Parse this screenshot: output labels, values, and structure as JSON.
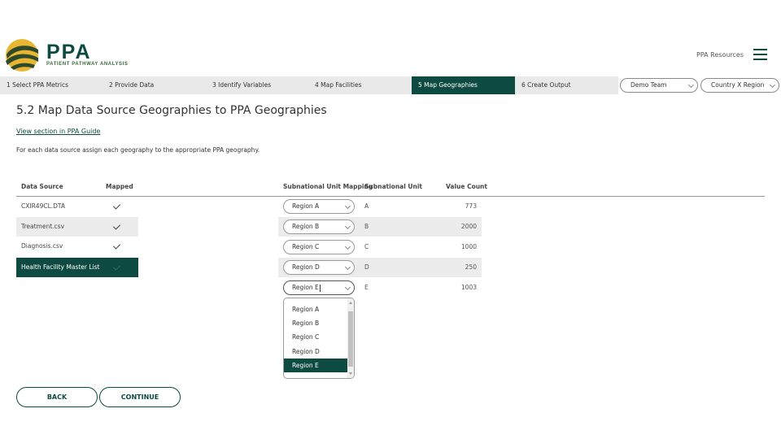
{
  "header": {
    "brand_name": "PPA",
    "brand_subtitle": "PATIENT PATHWAY ANALYSIS",
    "resources_label": "PPA Resources",
    "colors": {
      "brand_green": "#0d4a42",
      "logo_yellow": "#e9b634",
      "logo_dark_green": "#2e4a2a"
    }
  },
  "steps": [
    {
      "label": "1 Select PPA Metrics",
      "active": false
    },
    {
      "label": "2 Provide Data",
      "active": false
    },
    {
      "label": "3 Identify Variables",
      "active": false
    },
    {
      "label": "4 Map Facilities",
      "active": false
    },
    {
      "label": "5 Map Geographies",
      "active": true
    },
    {
      "label": "6 Create Output",
      "active": false
    }
  ],
  "selectors": {
    "team": "Demo Team",
    "region": "Country X Region"
  },
  "page": {
    "title": "5.2 Map Data Source Geographies to PPA Geographies",
    "guide_link": "View section in PPA Guide",
    "instructions": "For each data source assign each geography to the appropriate PPA geography."
  },
  "left_table": {
    "headers": {
      "data_source": "Data Source",
      "mapped": "Mapped"
    },
    "rows": [
      {
        "name": "CXIR49CL.DTA",
        "mapped": true,
        "shaded": false,
        "selected": false
      },
      {
        "name": "Treatment.csv",
        "mapped": true,
        "shaded": true,
        "selected": false
      },
      {
        "name": "Diagnosis.csv",
        "mapped": true,
        "shaded": false,
        "selected": false
      },
      {
        "name": "Health Facility Master List",
        "mapped": true,
        "shaded": false,
        "selected": true
      }
    ]
  },
  "right_table": {
    "headers": {
      "mapping": "Subnational Unit Mapping",
      "unit": "Subnational Unit",
      "count": "Value Count"
    },
    "rows": [
      {
        "mapping": "Region A",
        "unit": "A",
        "count": "773",
        "shaded": false
      },
      {
        "mapping": "Region B",
        "unit": "B",
        "count": "2000",
        "shaded": true
      },
      {
        "mapping": "Region C",
        "unit": "C",
        "count": "1000",
        "shaded": false
      },
      {
        "mapping": "Region D",
        "unit": "D",
        "count": "250",
        "shaded": true
      },
      {
        "mapping": "Region E",
        "unit": "E",
        "count": "1003",
        "shaded": false,
        "focused": true
      }
    ]
  },
  "dropdown": {
    "options": [
      "Region A",
      "Region B",
      "Region C",
      "Region D",
      "Region E"
    ],
    "highlighted": "Region E"
  },
  "buttons": {
    "back": "BACK",
    "continue": "CONTINUE"
  }
}
